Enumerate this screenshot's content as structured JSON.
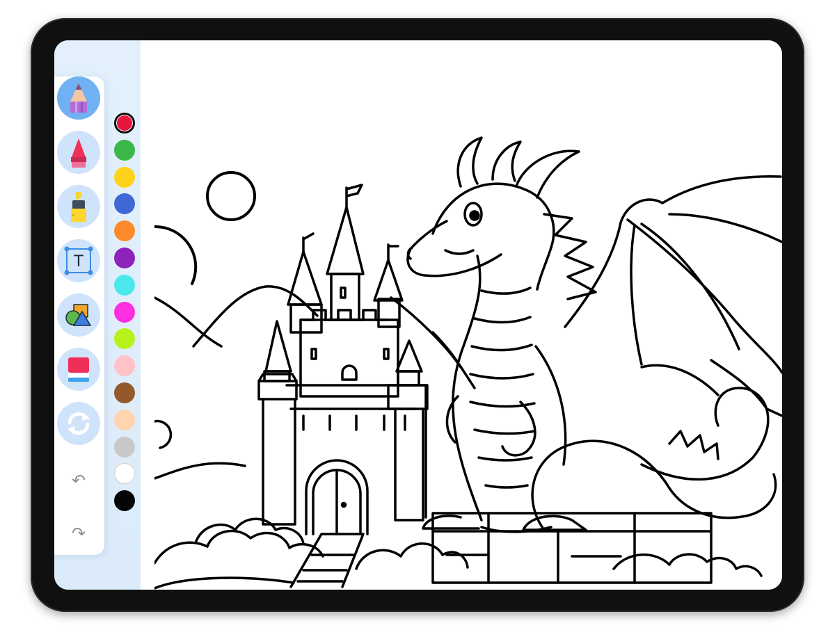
{
  "app": {
    "tools": [
      {
        "name": "pencil",
        "icon": "pencil-icon",
        "active": true
      },
      {
        "name": "marker",
        "icon": "marker-icon",
        "active": false
      },
      {
        "name": "highlighter",
        "icon": "highlighter-icon",
        "active": false
      },
      {
        "name": "text",
        "icon": "text-tool-icon",
        "label": "T",
        "active": false
      },
      {
        "name": "shapes",
        "icon": "shapes-icon",
        "active": false
      },
      {
        "name": "eraser",
        "icon": "eraser-icon",
        "active": false
      },
      {
        "name": "refresh",
        "icon": "refresh-icon",
        "active": false
      }
    ],
    "history": {
      "undo_icon": "↶",
      "redo_icon": "↷"
    },
    "palette": {
      "selected": "#e8163c",
      "colors": [
        "#e8163c",
        "#3cb84a",
        "#ffd21a",
        "#3f67d6",
        "#ff8a2b",
        "#8f22b8",
        "#4ae8ea",
        "#ff2ee0",
        "#b6f21a",
        "#ffc2c6",
        "#94592a",
        "#ffd4ae",
        "#c8c8c8",
        "#ffffff",
        "#050505"
      ]
    },
    "canvas": {
      "artwork": "castle-and-dragon-coloring-page"
    }
  }
}
